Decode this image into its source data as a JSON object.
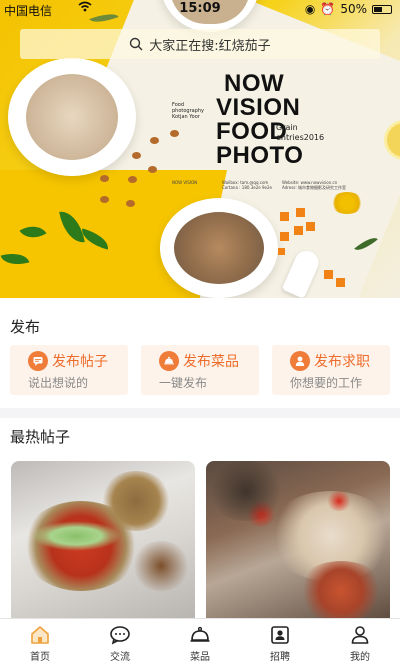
{
  "status_bar": {
    "carrier": "中国电信",
    "time": "15:09",
    "battery": "50%",
    "battery_level": 0.5
  },
  "search": {
    "placeholder": "大家正在搜:红烧茄子"
  },
  "banner": {
    "title_lines": [
      "NOW",
      "VISION",
      "FOOD",
      "PHOTO"
    ],
    "grain_lines": [
      "Grain",
      "entries2016"
    ],
    "food_photography_lines": [
      "Food photography",
      "Kotjan Yoor"
    ],
    "now_vision_tag": "NOW VISION",
    "contact_left": [
      "Wailbox: tam.@qq.com",
      "Cortana : 180.3e2e 9e2e"
    ],
    "contact_right": [
      "Website: www.nowvision.cn",
      "Adress: 城市食物摄影及研究工作室"
    ]
  },
  "publish": {
    "title": "发布",
    "cards": [
      {
        "label": "发布帖子",
        "desc": "说出想说的",
        "icon": "chat-bubble-icon"
      },
      {
        "label": "发布菜品",
        "desc": "一键发布",
        "icon": "cloche-icon"
      },
      {
        "label": "发布求职",
        "desc": "你想要的工作",
        "icon": "person-icon"
      }
    ]
  },
  "hot_posts": {
    "title": "最热帖子"
  },
  "bottom_nav": [
    {
      "label": "首页",
      "icon": "home-icon",
      "active": true
    },
    {
      "label": "交流",
      "icon": "chat-icon",
      "active": false
    },
    {
      "label": "菜品",
      "icon": "cloche-icon",
      "active": false
    },
    {
      "label": "招聘",
      "icon": "contact-card-icon",
      "active": false
    },
    {
      "label": "我的",
      "icon": "user-icon",
      "active": false
    }
  ],
  "colors": {
    "accent": "#ee6c2b",
    "card_bg": "#fdf3ea",
    "home_active": "#f0a03c"
  }
}
